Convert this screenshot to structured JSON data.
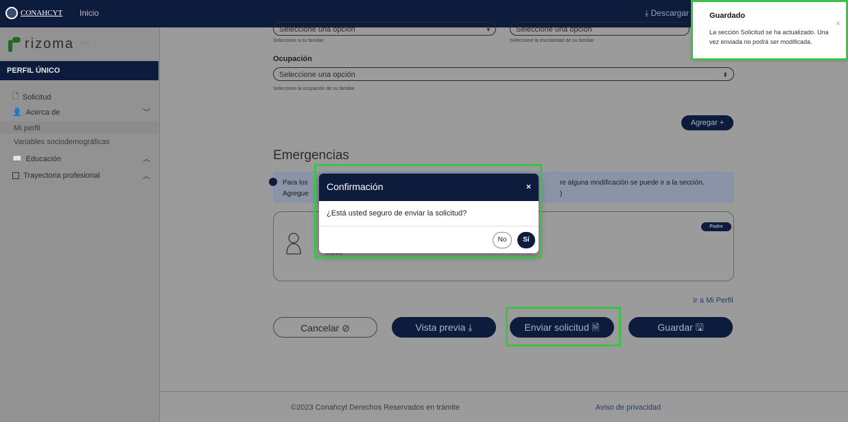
{
  "topbar": {
    "logo_text": "CONAHCYT",
    "home_label": "Inicio",
    "download_label": "⤓ Descargar"
  },
  "sidebar": {
    "brand": "rizoma",
    "brand_small": "2023",
    "section_title": "PERFIL ÚNICO",
    "items": [
      {
        "label": "Solicitud"
      },
      {
        "label": "Acerca de"
      },
      {
        "label": "Mi perfil"
      },
      {
        "label": "Variables sociodemográficas"
      },
      {
        "label": "Educación"
      },
      {
        "label": "Trayectoria profesional"
      }
    ]
  },
  "form": {
    "select_familiar_value": "Seleccione una opción",
    "select_familiar_hint": "Seleccione a su familiar",
    "select_escolaridad_value": "Seleccione una opción",
    "select_escolaridad_hint": "Seleccione la escolaridad de su familiar",
    "ocupacion_label": "Ocupación",
    "ocupacion_value": "Seleccione una opción",
    "ocupacion_hint": "Seleccione la ocupación de su familiar",
    "add_button": "Agregar +"
  },
  "emergencias": {
    "heading": "Emergencias",
    "info_start": "Para los",
    "info_second_line": "Agregue",
    "info_end": "re alguna modificación se puede ir a la sección.",
    "info_end2": ")",
    "contact_role": "Padre",
    "contact_line": "móvil"
  },
  "links": {
    "go_profile": "Ir a Mi Perfil"
  },
  "actions": {
    "cancel": "Cancelar ⊘",
    "preview": "Vista previa ⤓",
    "send": "Enviar solicitud 🗎",
    "save": "Guardar 🖫"
  },
  "footer": {
    "copyright": "©2023 Conahcyt Derechos Reservados en trámite",
    "privacy": "Aviso de privacidad"
  },
  "toast": {
    "title": "Guardado",
    "line1": "La sección Solicitud se ha actualizado. Una",
    "line2": "vez enviada no podrá ser modificada.",
    "close": "×"
  },
  "modal": {
    "title": "Confirmación",
    "close": "×",
    "question": "¿Está usted seguro de enviar la solicitud?",
    "no": "No",
    "yes": "Sí"
  },
  "colors": {
    "primary": "#0d1b3d",
    "highlight": "#3ec245",
    "overlay": "#9b9b9b"
  }
}
